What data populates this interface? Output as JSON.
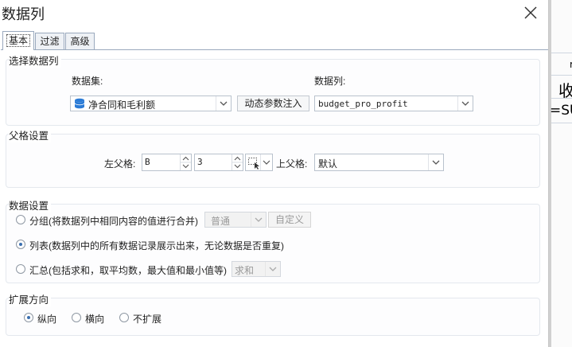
{
  "dialog": {
    "title": "数据列",
    "tabs": [
      {
        "label": "基本"
      },
      {
        "label": "过滤"
      },
      {
        "label": "高级"
      }
    ]
  },
  "select_section": {
    "title": "选择数据列",
    "dataset_label": "数据集:",
    "dataset_value": "净合同和毛利额",
    "dynamic_param_button": "动态参数注入",
    "column_label": "数据列:",
    "column_value": "budget_pro_profit"
  },
  "parent_section": {
    "title": "父格设置",
    "left_parent_label": "左父格:",
    "left_col": "B",
    "left_row": "3",
    "upper_parent_label": "上父格:",
    "upper_parent_value": "默认"
  },
  "data_section": {
    "title": "数据设置",
    "options": [
      {
        "label": "分组(将数据列中相同内容的值进行合并)",
        "checked": false
      },
      {
        "label": "列表(数据列中的所有数据记录展示出来，无论数据是否重复)",
        "checked": true
      },
      {
        "label": "汇总(包括求和，取平均数，最大值和最小值等)",
        "checked": false
      }
    ],
    "group_mode_value": "普通",
    "custom_button": "自定义",
    "summary_value": "求和"
  },
  "expand_section": {
    "title": "扩展方向",
    "options": [
      {
        "label": "纵向",
        "checked": true
      },
      {
        "label": "横向",
        "checked": false
      },
      {
        "label": "不扩展",
        "checked": false
      }
    ]
  },
  "background_sheet": {
    "cell_top": "r",
    "cell_mid": "收",
    "cell_formula": "=SU"
  },
  "colors": {
    "accent": "#3a6fb0",
    "dataset_icon": "#2b7bd6",
    "border": "#b9c2cd"
  }
}
